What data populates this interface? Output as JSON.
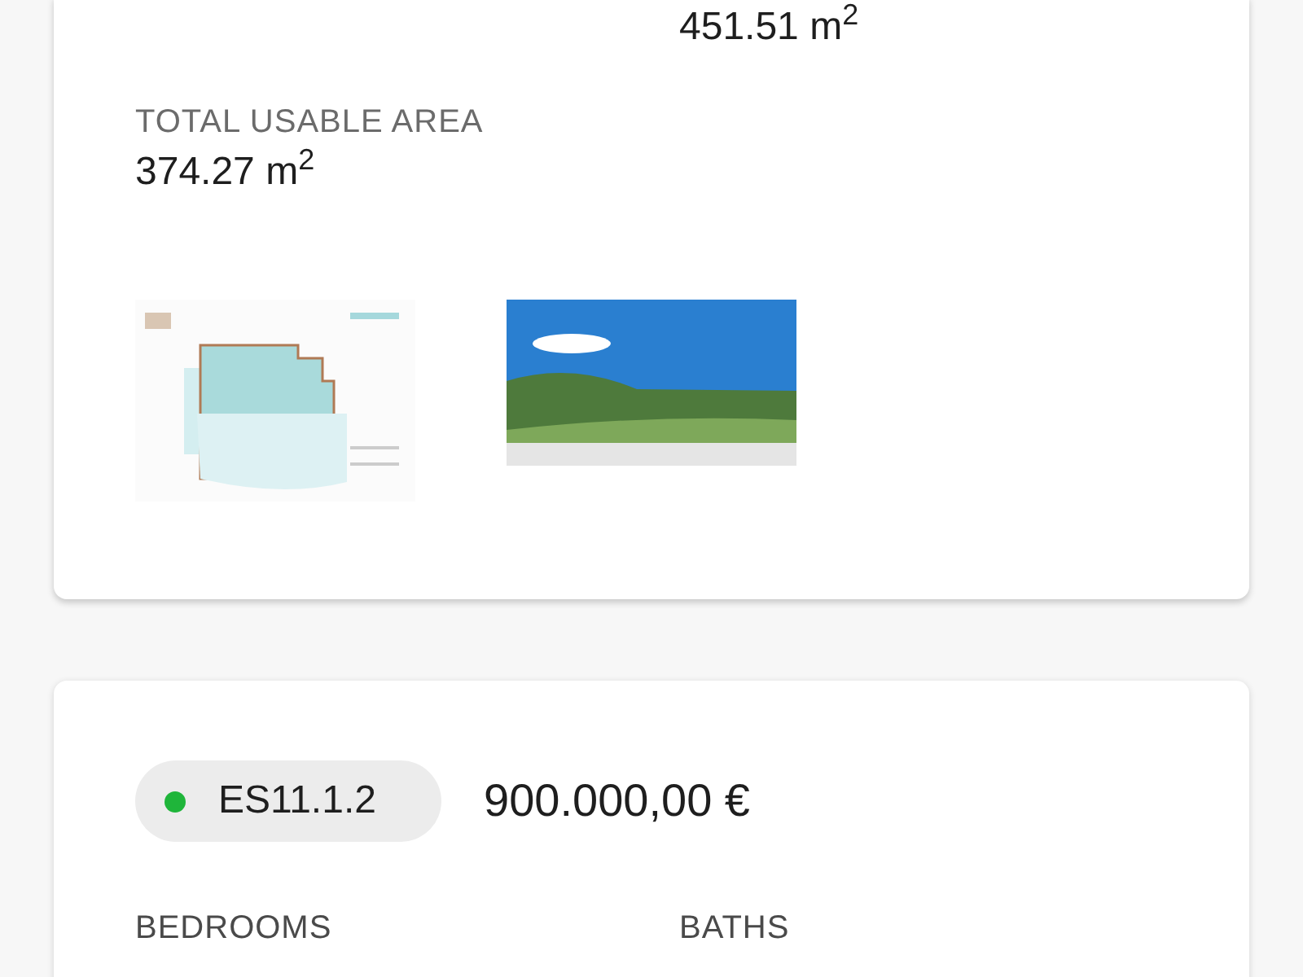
{
  "area_card": {
    "top_value": "451.51 m$^{2}$",
    "label": "TOTAL USABLE AREA",
    "value": "374.27 m$^{2}$"
  },
  "unit_card": {
    "status": {
      "code": "ES11.1.2",
      "color": "#1fb53a"
    },
    "price": "900.000,00 €",
    "fields": [
      {
        "label": "BEDROOMS"
      },
      {
        "label": "BATHS"
      }
    ]
  }
}
